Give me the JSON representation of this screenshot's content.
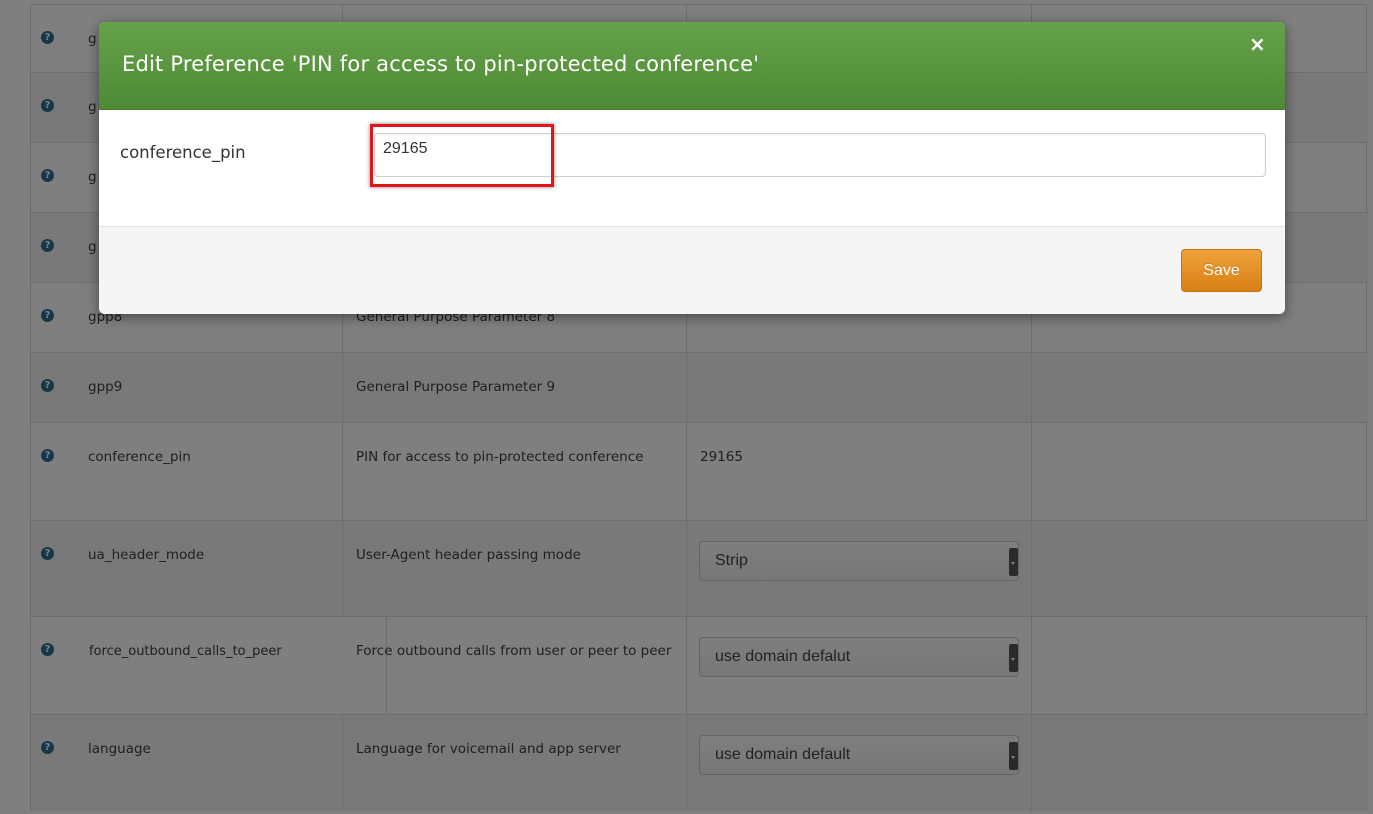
{
  "modal": {
    "title": "Edit Preference 'PIN for access to pin-protected conference'",
    "close_glyph": "×",
    "field_label": "conference_pin",
    "field_value": "29165",
    "save_label": "Save"
  },
  "table": {
    "help_glyph": "?",
    "rows": [
      {
        "name": "g",
        "description": "",
        "value": ""
      },
      {
        "name": "g",
        "description": "",
        "value": ""
      },
      {
        "name": "g",
        "description": "",
        "value": ""
      },
      {
        "name": "g",
        "description": "",
        "value": ""
      },
      {
        "name": "gpp8",
        "description": "General Purpose Parameter 8",
        "value": ""
      },
      {
        "name": "gpp9",
        "description": "General Purpose Parameter 9",
        "value": ""
      },
      {
        "name": "conference_pin",
        "description": "PIN for access to pin-protected conference",
        "value": "29165"
      },
      {
        "name": "ua_header_mode",
        "description": "User-Agent header passing mode",
        "select": "Strip"
      },
      {
        "name": "force_outbound_calls_to_peer",
        "description": "Force outbound calls from user or peer to peer",
        "select": "use domain defalut"
      },
      {
        "name": "language",
        "description": "Language for voicemail and app server",
        "select": "use domain default"
      }
    ]
  },
  "colors": {
    "header_green": "#5a9640",
    "save_orange": "#e58f23",
    "highlight_red": "#e3151a",
    "help_icon_blue": "#2b6f93"
  }
}
